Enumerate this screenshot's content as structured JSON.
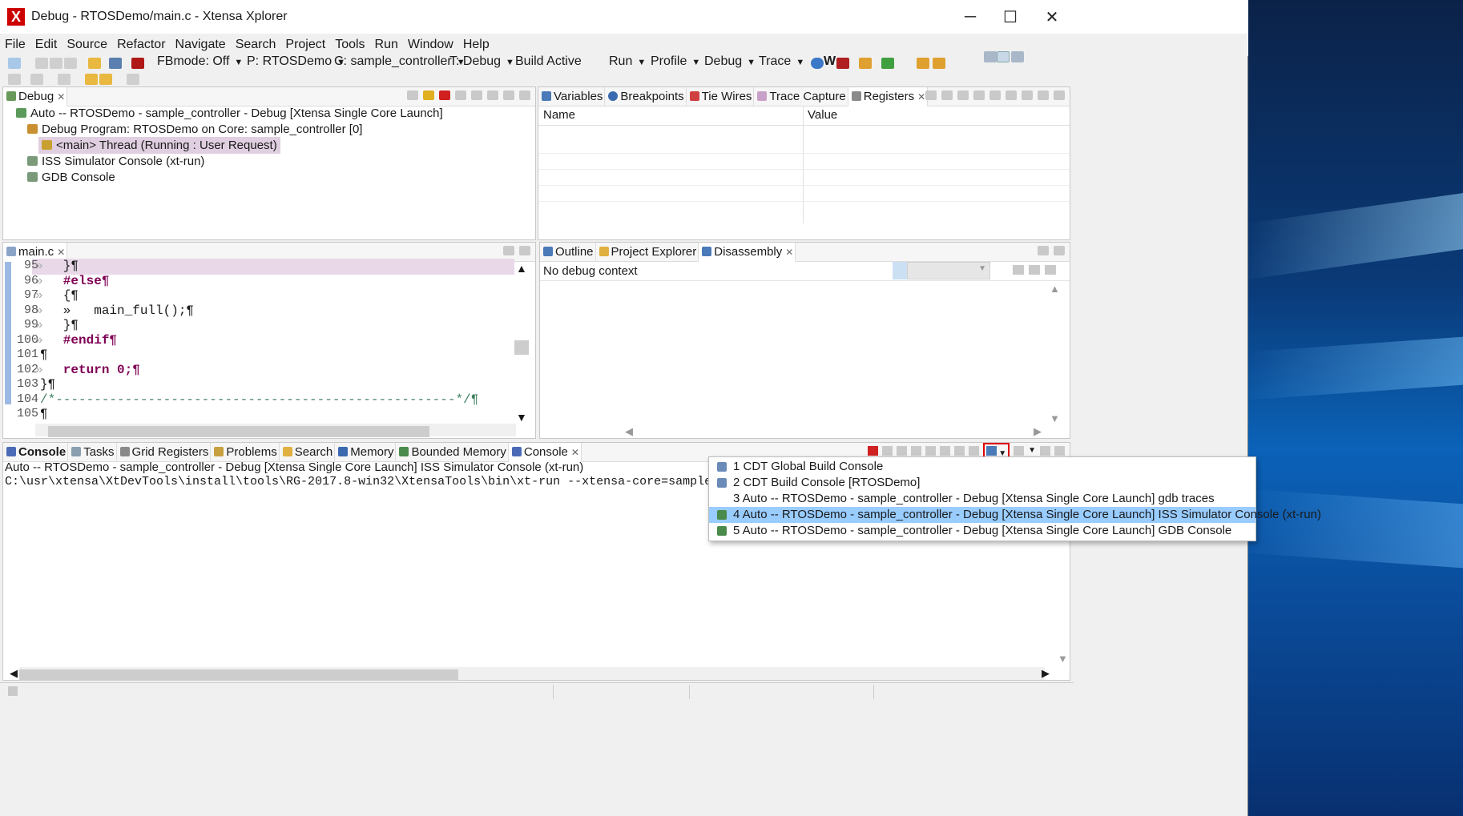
{
  "window": {
    "title": "Debug - RTOSDemo/main.c - Xtensa Xplorer",
    "logo": "X",
    "controls": {
      "minimize": "─",
      "maximize": "☐",
      "close": "✕"
    }
  },
  "menu": [
    "File",
    "Edit",
    "Source",
    "Refactor",
    "Navigate",
    "Search",
    "Project",
    "Tools",
    "Run",
    "Window",
    "Help"
  ],
  "toolbar": {
    "fbmode": "FBmode: Off",
    "project": "P: RTOSDemo",
    "config": "C: sample_controller",
    "target": "T: Debug",
    "build": "Build Active",
    "run": "Run",
    "profile": "Profile",
    "debug": "Debug",
    "trace": "Trace",
    "w": "W"
  },
  "debug_view": {
    "tab": "Debug",
    "tree": [
      "Auto -- RTOSDemo - sample_controller - Debug [Xtensa Single Core Launch]",
      "Debug Program: RTOSDemo on Core: sample_controller [0]",
      "<main> Thread (Running : User Request)",
      "ISS  Simulator Console (xt-run)",
      "GDB Console"
    ]
  },
  "variables_view": {
    "tabs": [
      "Variables",
      "Breakpoints",
      "Tie Wires",
      "Trace Capture",
      "Registers"
    ],
    "columns": [
      "Name",
      "Value"
    ]
  },
  "editor": {
    "tab": "main.c",
    "lines": [
      {
        "n": "95",
        "ind": "»",
        "code": "   }¶"
      },
      {
        "n": "96",
        "ind": "»",
        "code": "   #else¶"
      },
      {
        "n": "97",
        "ind": "»",
        "code": "   {¶"
      },
      {
        "n": "98",
        "ind": "»",
        "code": "   »   main_full();¶"
      },
      {
        "n": "99",
        "ind": "»",
        "code": "   }¶"
      },
      {
        "n": "100",
        "ind": "»",
        "code": "   #endif¶"
      },
      {
        "n": "101",
        "ind": "",
        "code": "¶"
      },
      {
        "n": "102",
        "ind": "»",
        "code": "   return 0;¶"
      },
      {
        "n": "103",
        "ind": "",
        "code": "}¶"
      },
      {
        "n": "104",
        "ind": "",
        "code": "/*----------------------------------------------------*/¶"
      },
      {
        "n": "105",
        "ind": "",
        "code": "¶"
      }
    ]
  },
  "disassembly_view": {
    "tabs": [
      "Outline",
      "Project Explorer",
      "Disassembly"
    ],
    "message": "No debug context"
  },
  "console_view": {
    "tabs": [
      "Console",
      "Tasks",
      "Grid Registers",
      "Problems",
      "Search",
      "Memory",
      "Bounded Memory",
      "Console"
    ],
    "header": "Auto -- RTOSDemo - sample_controller - Debug [Xtensa Single Core Launch] ISS  Simulator Console (xt-run)",
    "output": "C:\\usr\\xtensa\\XtDevTools\\install\\tools\\RG-2017.8-win32\\XtensaTools\\bin\\xt-run --xtensa-core=sample_con"
  },
  "console_menu": {
    "items": [
      "1 CDT Global Build Console",
      "2 CDT Build Console [RTOSDemo]",
      "3 Auto -- RTOSDemo - sample_controller - Debug [Xtensa Single Core Launch] gdb traces",
      "4 Auto -- RTOSDemo - sample_controller - Debug [Xtensa Single Core Launch] ISS  Simulator Console (xt-run)",
      "5 Auto -- RTOSDemo - sample_controller - Debug [Xtensa Single Core Launch] GDB Console"
    ],
    "selected_index": 3,
    "highlight_color": "#99ccff"
  },
  "colors": {
    "editor_current_line": "#e8d8e8",
    "selection": "#99ccff",
    "debug_highlight": "#e0cfe0",
    "red_box": "#e00000"
  }
}
